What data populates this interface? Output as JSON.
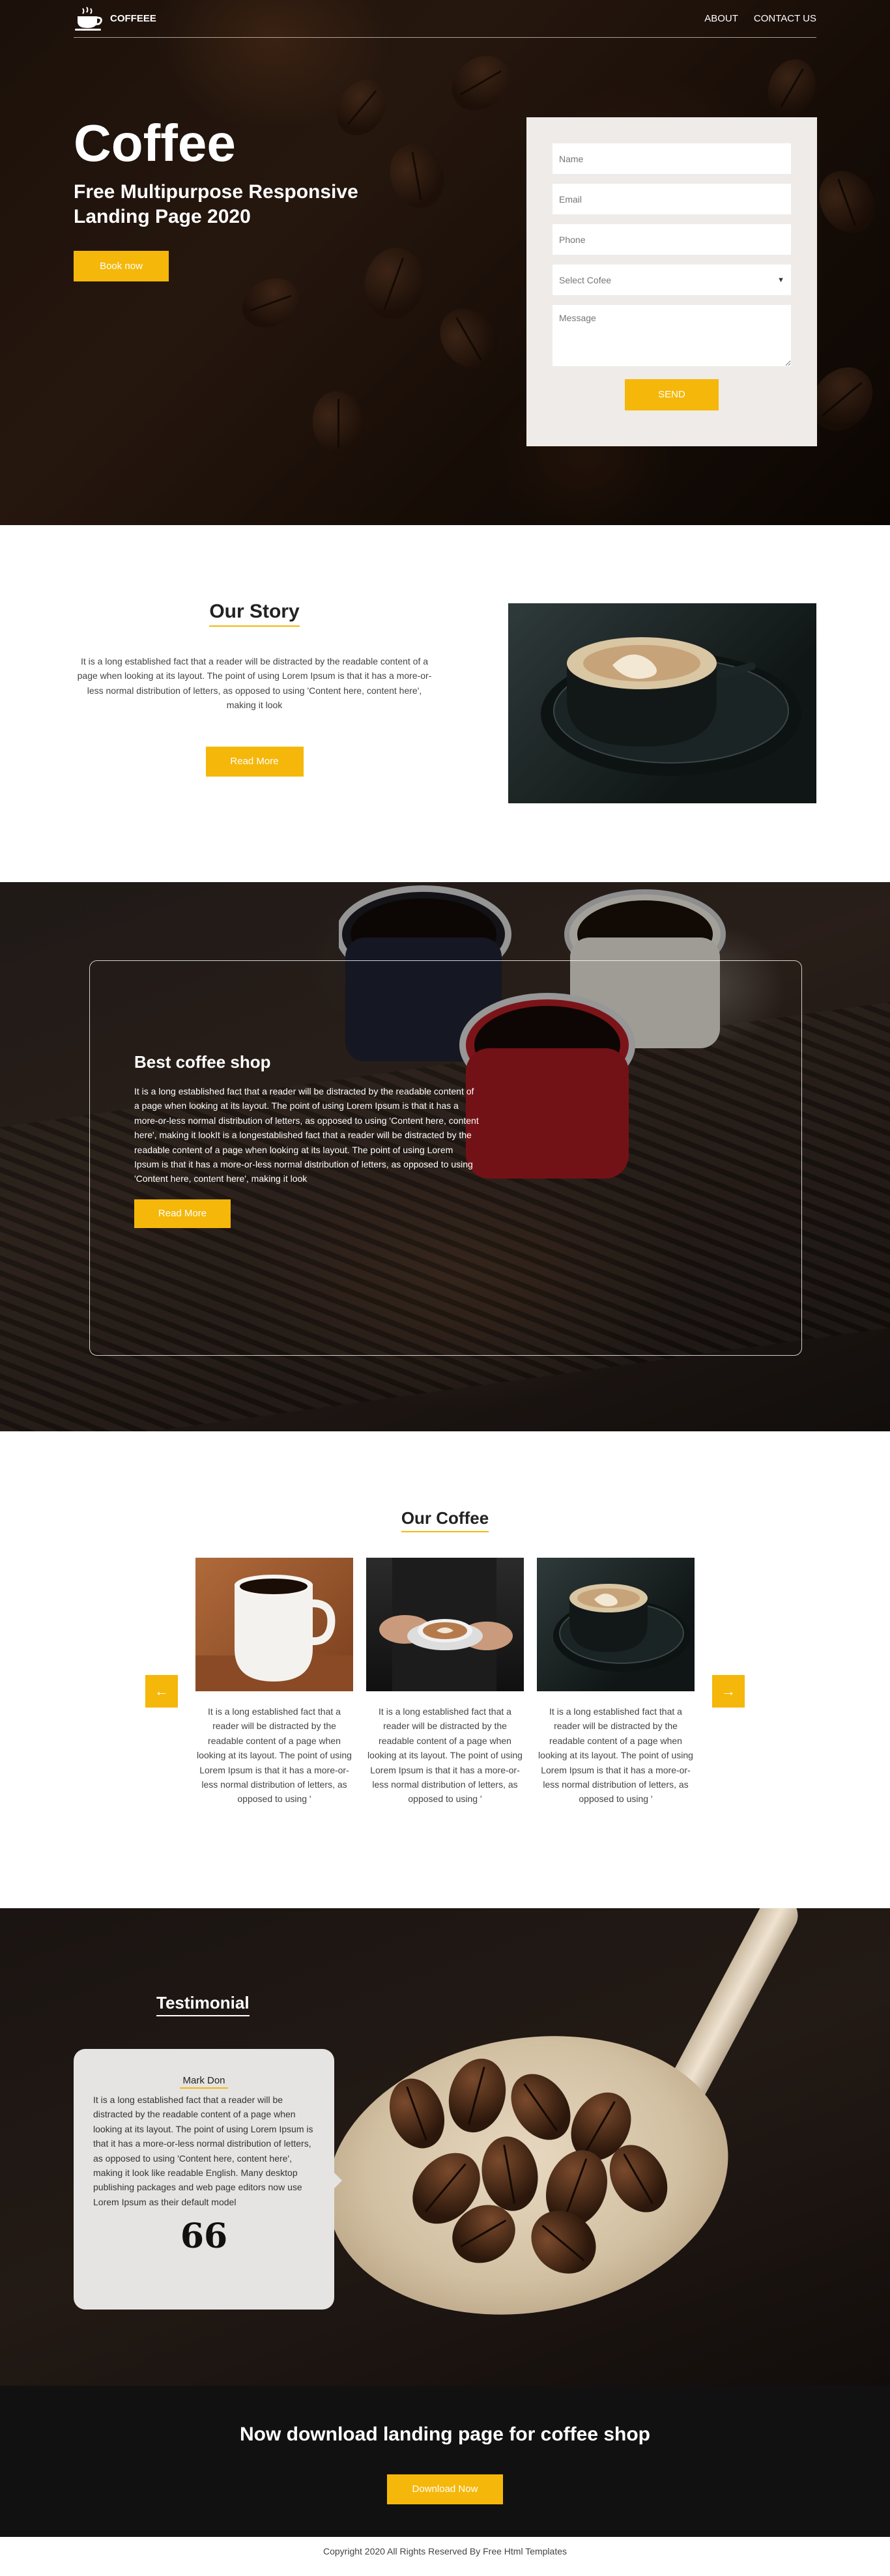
{
  "nav": {
    "logo_text": "COFFEEE",
    "links": [
      "ABOUT",
      "CONTACT US"
    ]
  },
  "hero": {
    "title": "Coffee",
    "subtitle": "Free Multipurpose Responsive Landing Page 2020",
    "button": "Book now"
  },
  "form": {
    "name_placeholder": "Name",
    "email_placeholder": "Email",
    "phone_placeholder": "Phone",
    "select_value": "Select Cofee",
    "message_placeholder": "Message",
    "send_button": "SEND"
  },
  "story": {
    "title": "Our Story",
    "text": "It is a long established fact that a reader will be distracted by the readable content of a page when looking at its layout. The point of using Lorem Ipsum is that it has a more-or-less normal distribution of letters, as opposed to using 'Content here, content here', making it look",
    "button": "Read More"
  },
  "shop": {
    "title": "Best coffee shop",
    "text": "It is a long established fact that a reader will be distracted by the readable content of a page when looking at its layout. The point of using Lorem Ipsum is that it has a more-or-less normal distribution of letters, as opposed to using 'Content here, content here', making it lookIt is a longestablished fact that a reader will be distracted by the readable content of a page when looking at its layout. The point of using Lorem Ipsum is that it has a more-or-less normal distribution of letters, as opposed to using 'Content here, content here', making it look",
    "button": "Read More"
  },
  "our_coffee": {
    "title": "Our Coffee",
    "cards": [
      {
        "text": "It is a long established fact that a reader will be distracted by the readable content of a page when looking at its layout. The point of using Lorem Ipsum is that it has a more-or-less normal distribution of letters, as opposed to using '"
      },
      {
        "text": "It is a long established fact that a reader will be distracted by the readable content of a page when looking at its layout. The point of using Lorem Ipsum is that it has a more-or-less normal distribution of letters, as opposed to using '"
      },
      {
        "text": "It is a long established fact that a reader will be distracted by the readable content of a page when looking at its layout. The point of using Lorem Ipsum is that it has a more-or-less normal distribution of letters, as opposed to using '"
      }
    ],
    "prev_icon": "arrow-left-icon",
    "next_icon": "arrow-right-icon"
  },
  "testimonial": {
    "title": "Testimonial",
    "name": "Mark Don",
    "text": "It is a long established fact that a reader will be distracted by the readable content of a page when looking at its layout. The point of using Lorem Ipsum is that it has a more-or-less normal distribution of letters, as opposed to using 'Content here, content here', making it look like readable English. Many desktop publishing packages and web page editors now use Lorem Ipsum as their default model",
    "quote_icon": "66"
  },
  "download": {
    "title": "Now download landing page for coffee shop",
    "button": "Download Now"
  },
  "footer": {
    "text": "Copyright 2020 All Rights Reserved By Free Html Templates"
  },
  "colors": {
    "accent": "#f5b70a",
    "dark": "#111111",
    "form_bg": "#efebe8"
  }
}
